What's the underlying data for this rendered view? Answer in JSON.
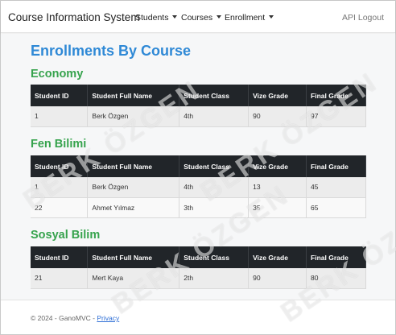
{
  "navbar": {
    "brand": "Course Information System",
    "items": [
      {
        "label": "Students"
      },
      {
        "label": "Courses"
      },
      {
        "label": "Enrollment"
      }
    ],
    "right_label": "API Logout"
  },
  "page": {
    "title": "Enrollments By Course"
  },
  "columns": [
    "Student ID",
    "Student Full Name",
    "Student Class",
    "Vize Grade",
    "Final Grade"
  ],
  "courses": [
    {
      "name": "Economy",
      "rows": [
        {
          "id": "1",
          "name": "Berk Özgen",
          "class": "4th",
          "vize": "90",
          "final": "97"
        }
      ]
    },
    {
      "name": "Fen Bilimi",
      "rows": [
        {
          "id": "1",
          "name": "Berk Özgen",
          "class": "4th",
          "vize": "13",
          "final": "45"
        },
        {
          "id": "22",
          "name": "Ahmet Yılmaz",
          "class": "3th",
          "vize": "35",
          "final": "65"
        }
      ]
    },
    {
      "name": "Sosyal Bilim",
      "rows": [
        {
          "id": "21",
          "name": "Mert Kaya",
          "class": "2th",
          "vize": "90",
          "final": "80"
        }
      ]
    }
  ],
  "footer": {
    "text": "© 2024 - GanoMVC -",
    "link": "Privacy"
  },
  "watermark": {
    "text": "BERK ÖZGEN"
  },
  "colors": {
    "title_blue": "#2f89d6",
    "course_green": "#36a34d",
    "table_header": "#212529"
  }
}
